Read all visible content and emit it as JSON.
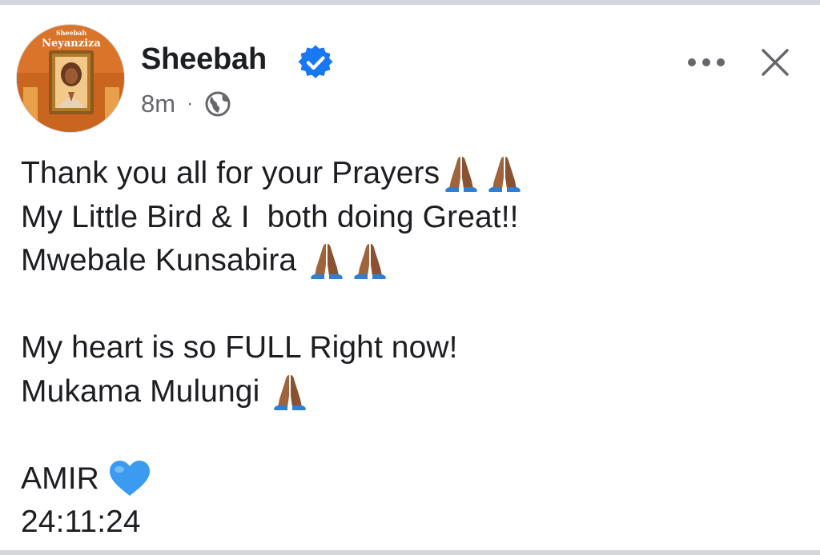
{
  "post": {
    "author": {
      "name": "Sheebah",
      "verified": true,
      "avatar_text_top": "Sheebah",
      "avatar_text_main": "Neyanziza"
    },
    "timestamp": "8m",
    "separator": "·",
    "audience_icon": "globe-icon",
    "actions": {
      "more_icon": "more-options-icon",
      "close_icon": "close-icon"
    },
    "lines": [
      {
        "text": "Thank you all for your Prayers",
        "emojis": [
          "folded-hands",
          "folded-hands"
        ]
      },
      {
        "text": "My Little Bird & I  both doing Great!!",
        "emojis": []
      },
      {
        "text": "Mwebale Kunsabira ",
        "emojis": [
          "folded-hands",
          "folded-hands"
        ]
      },
      {
        "text": "",
        "emojis": []
      },
      {
        "text": "My heart is so FULL Right now!",
        "emojis": []
      },
      {
        "text": "Mukama Mulungi ",
        "emojis": [
          "folded-hands"
        ]
      },
      {
        "text": "",
        "emojis": []
      },
      {
        "text": "AMIR ",
        "emojis": [
          "blue-heart"
        ]
      },
      {
        "text": "24:11:24",
        "emojis": []
      }
    ]
  },
  "colors": {
    "verified_blue": "#1877f2",
    "meta_gray": "#65676b",
    "blue_heart": "#3b9bf0",
    "hands_skin": "#a0643c"
  }
}
